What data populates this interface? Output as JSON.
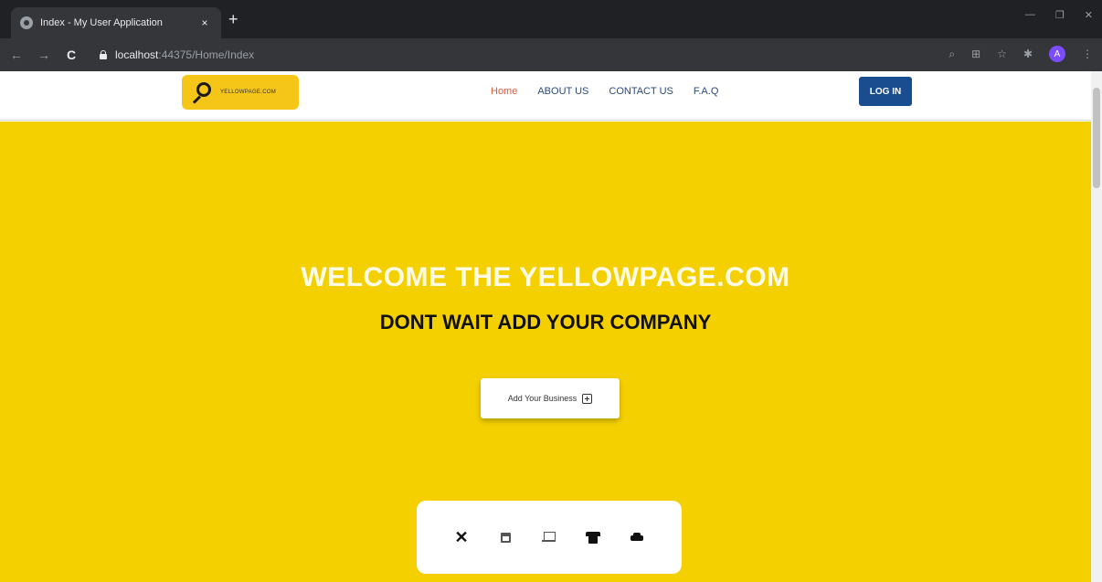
{
  "browser": {
    "tab_title": "Index - My User Application",
    "tab_close": "×",
    "new_tab": "+",
    "url_host": "localhost",
    "url_rest": ":44375/Home/Index",
    "profile_initial": "A"
  },
  "site": {
    "logo_text": "YELLOWPAGE.COM",
    "nav": {
      "home": "Home",
      "about": "ABOUT US",
      "contact": "CONTACT US",
      "faq": "F.A.Q",
      "login": "LOG IN"
    }
  },
  "hero": {
    "title": "WELCOME THE YELLOWPAGE.COM",
    "subtitle": "DONT WAIT ADD YOUR COMPANY",
    "add_button": "Add Your Business"
  },
  "categories": {
    "icons": [
      "close-icon",
      "calendar-icon",
      "laptop-icon",
      "shirt-icon",
      "car-icon"
    ]
  },
  "colors": {
    "hero_bg": "#f5d000",
    "login_bg": "#1a4d8f",
    "active_nav": "#e0583a",
    "nav_link": "#2b4a7c"
  }
}
